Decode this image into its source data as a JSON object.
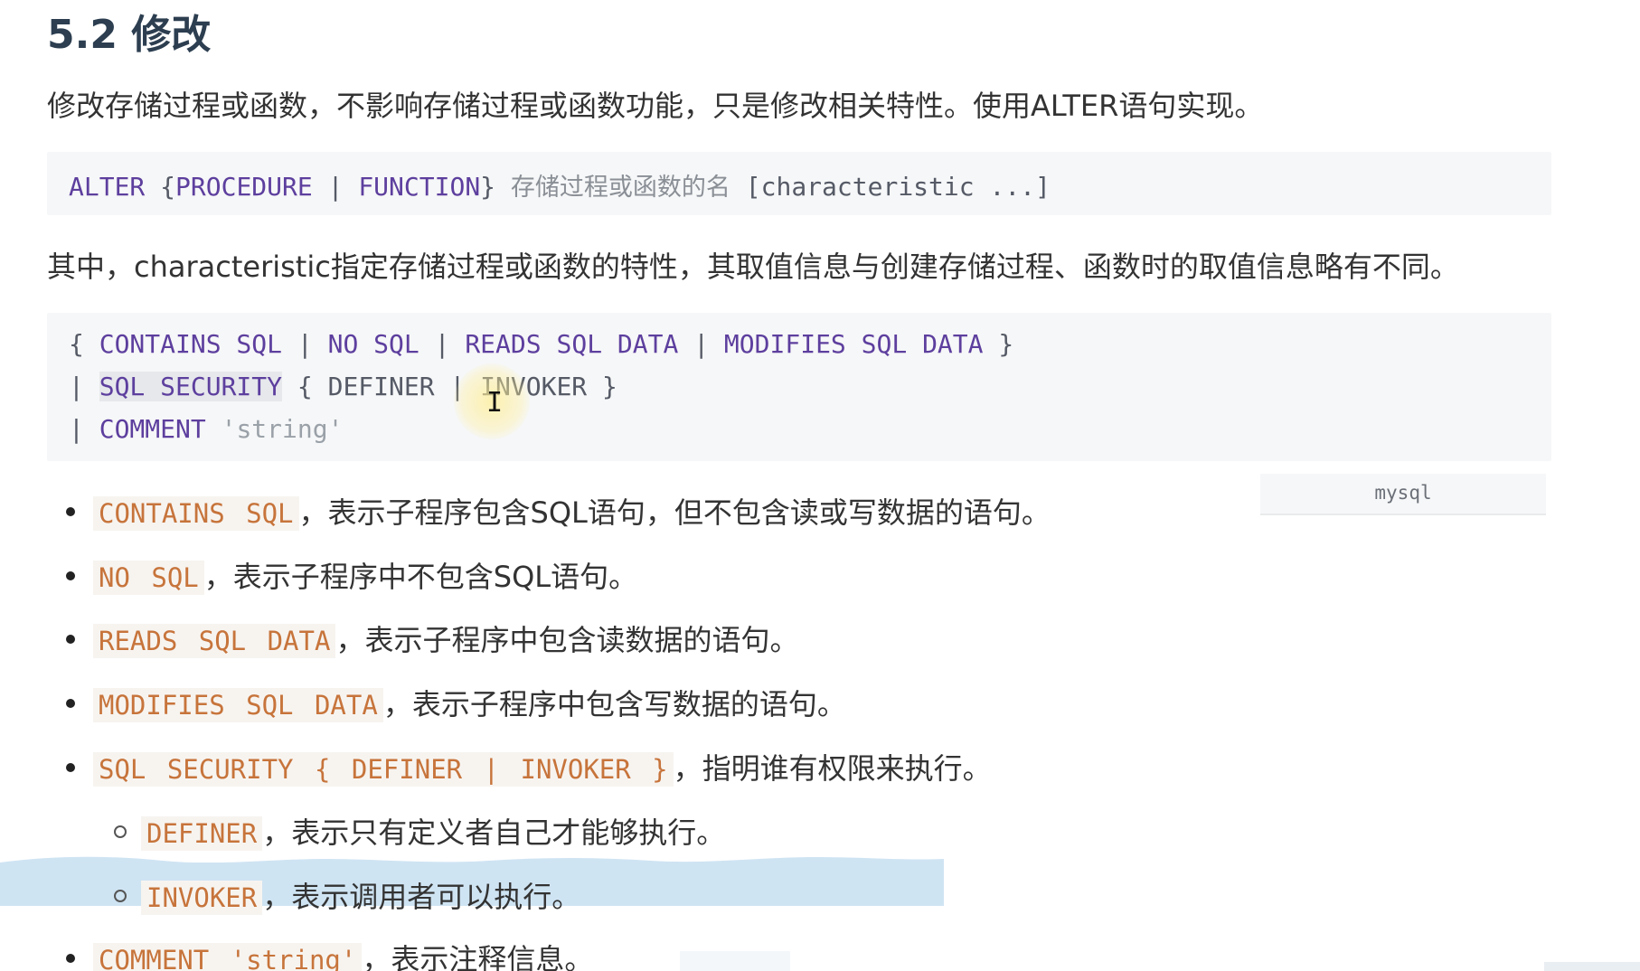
{
  "heading": "5.2 修改",
  "intro": "修改存储过程或函数，不影响存储过程或函数功能，只是修改相关特性。使用ALTER语句实现。",
  "alter_code": {
    "kw1": "ALTER",
    "op1": " {",
    "kw2": "PROCEDURE",
    "op2": " | ",
    "kw3": "FUNCTION",
    "op3": "} ",
    "name": "存储过程或函数的名",
    "rest": " [characteristic ...]"
  },
  "note": "其中，characteristic指定存储过程或函数的特性，其取值信息与创建存储过程、函数时的取值信息略有不同。",
  "char_code": {
    "line1": [
      {
        "t": "{ ",
        "c": "op"
      },
      {
        "t": "CONTAINS SQL",
        "c": "kw"
      },
      {
        "t": " | ",
        "c": "op"
      },
      {
        "t": "NO SQL",
        "c": "kw"
      },
      {
        "t": " | ",
        "c": "op"
      },
      {
        "t": "READS SQL DATA",
        "c": "kw"
      },
      {
        "t": " | ",
        "c": "op"
      },
      {
        "t": "MODIFIES SQL DATA",
        "c": "kw"
      },
      {
        "t": " }",
        "c": "op"
      }
    ],
    "line2": [
      {
        "t": "| ",
        "c": "op"
      },
      {
        "t": "SQL SECURITY",
        "c": "kw hl"
      },
      {
        "t": " { DEFINER | INVOKER }",
        "c": "op"
      }
    ],
    "line3": [
      {
        "t": "| ",
        "c": "op"
      },
      {
        "t": "COMMENT",
        "c": "kw"
      },
      {
        "t": " ",
        "c": "op"
      },
      {
        "t": "'string'",
        "c": "str"
      }
    ]
  },
  "lang_label": "mysql",
  "bullets": [
    {
      "code": "CONTAINS SQL",
      "text": "，表示子程序包含SQL语句，但不包含读或写数据的语句。"
    },
    {
      "code": "NO SQL",
      "text": "，表示子程序中不包含SQL语句。"
    },
    {
      "code": "READS SQL DATA",
      "text": "，表示子程序中包含读数据的语句。"
    },
    {
      "code": "MODIFIES SQL DATA",
      "text": "，表示子程序中包含写数据的语句。"
    },
    {
      "code": "SQL SECURITY { DEFINER | INVOKER }",
      "text": "，指明谁有权限来执行。"
    }
  ],
  "sub_bullets": [
    {
      "code": "DEFINER",
      "text": "，表示只有定义者自己才能够执行。"
    },
    {
      "code": "INVOKER",
      "text": "，表示调用者可以执行。"
    }
  ],
  "last_bullet": {
    "code": "COMMENT 'string'",
    "text": "，表示注释信息。"
  },
  "colors": {
    "keyword": "#5d3f9e",
    "inline_code": "#c7743b",
    "code_bg": "#f6f7f8",
    "highlight": "#cfe4f3"
  }
}
